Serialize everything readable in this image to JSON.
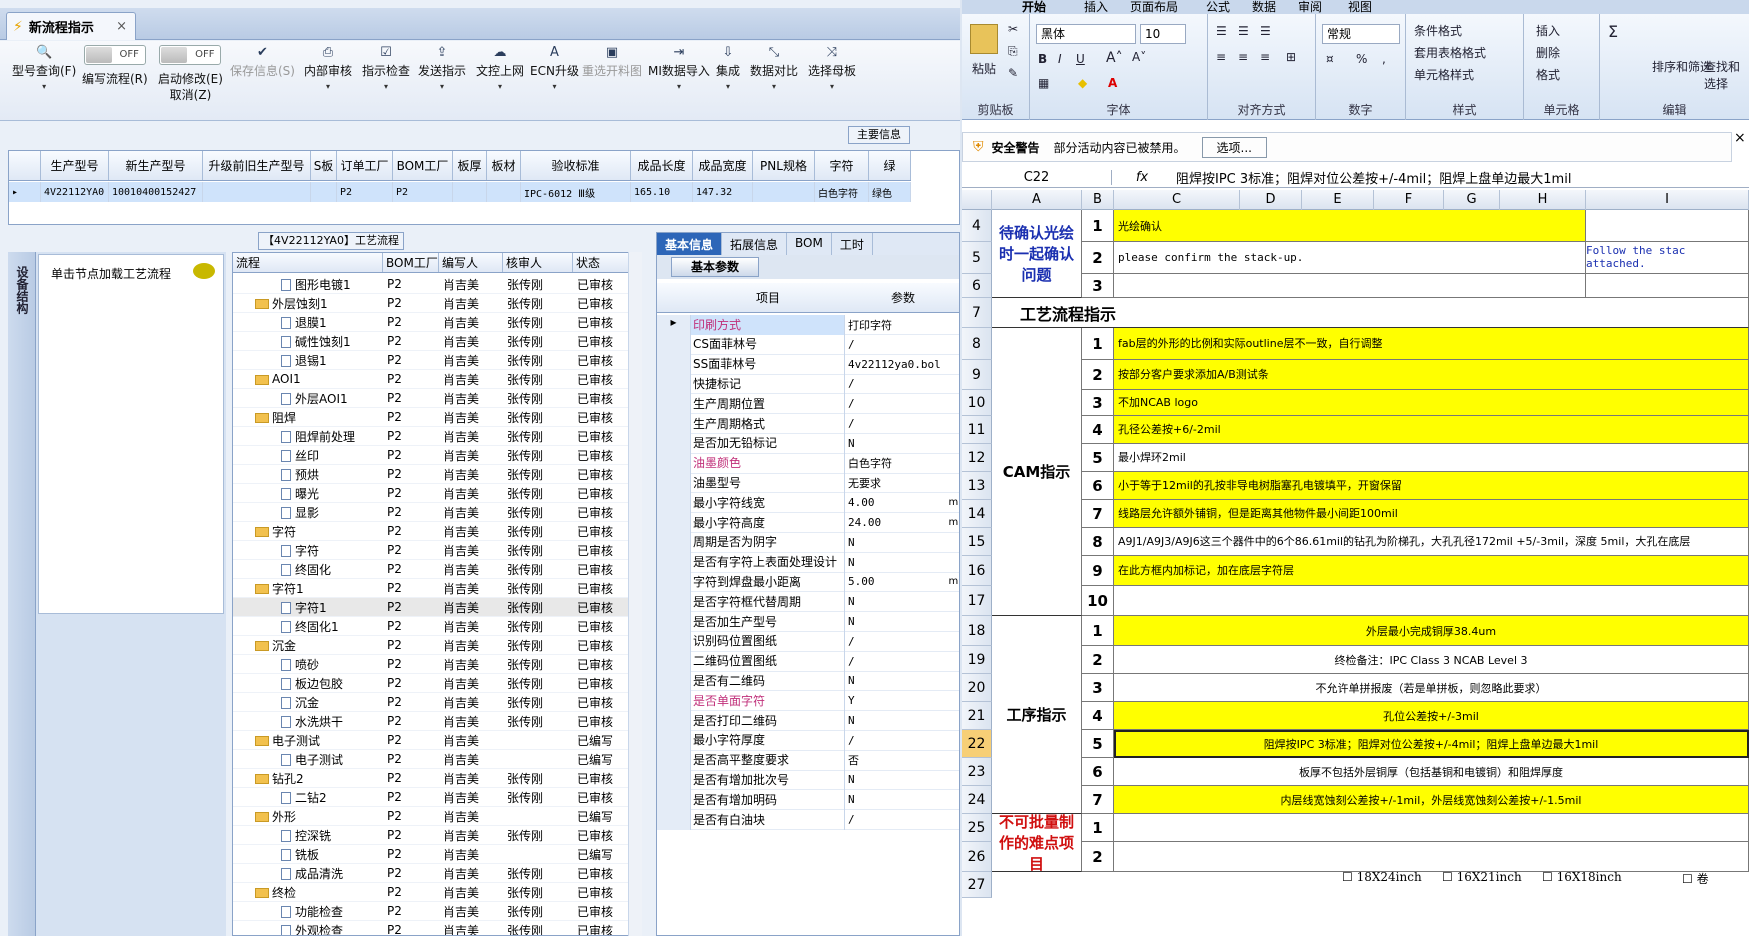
{
  "left": {
    "tab_title": "新流程指示",
    "toolbar": [
      {
        "label": "型号查询(F)",
        "icon": "search-icon"
      },
      {
        "label": "编写流程(R)",
        "icon": "toggle-off"
      },
      {
        "label": "启动修改(E)",
        "sub": "取消(Z)",
        "icon": "toggle-off"
      },
      {
        "label": "保存信息(S)",
        "icon": "check-icon",
        "disabled": true
      },
      {
        "label": "内部审核",
        "icon": "printer-icon"
      },
      {
        "label": "指示检查",
        "icon": "checkbox-icon"
      },
      {
        "label": "发送指示",
        "icon": "upload-icon"
      },
      {
        "label": "文控上网",
        "icon": "cloud-upload-icon"
      },
      {
        "label": "ECN升级",
        "icon": "ecn-icon"
      },
      {
        "label": "重选开料图",
        "icon": "image-icon",
        "disabled": true
      },
      {
        "label": "MI数据导入",
        "icon": "import-icon"
      },
      {
        "label": "集成",
        "icon": "download-icon"
      },
      {
        "label": "数据对比",
        "icon": "compare-icon"
      },
      {
        "label": "选择母板",
        "icon": "shuffle-icon"
      }
    ],
    "toggle_text": "OFF",
    "main_info_tab": "主要信息",
    "grid_headers": [
      "生产型号",
      "新生产型号",
      "升级前旧生产型号",
      "S板",
      "订单工厂",
      "BOM工厂",
      "板厚",
      "板材",
      "验收标准",
      "成品长度",
      "成品宽度",
      "PNL规格",
      "字符",
      "绿"
    ],
    "grid_row": [
      "4V22112YA0",
      "10010400152427",
      "",
      "",
      "P2",
      "P2",
      "",
      "",
      "IPC-6012 Ⅲ级",
      "165.10",
      "147.32",
      "",
      "白色字符",
      "绿色"
    ],
    "flow_title": "【4V22112YA0】工艺流程",
    "sidebar_label": "设备结构",
    "left_hint": "单击节点加载工艺流程",
    "tree_headers": [
      "流程",
      "BOM工厂",
      "编写人",
      "核审人",
      "状态"
    ],
    "tree_rows": [
      {
        "name": "图形电镀1",
        "lvl": 2,
        "bom": "P2",
        "w": "肖吉美",
        "r": "张传刚",
        "s": "已审核"
      },
      {
        "name": "外层蚀刻1",
        "lvl": 1,
        "bom": "P2",
        "w": "肖吉美",
        "r": "张传刚",
        "s": "已审核"
      },
      {
        "name": "退膜1",
        "lvl": 2,
        "bom": "P2",
        "w": "肖吉美",
        "r": "张传刚",
        "s": "已审核"
      },
      {
        "name": "碱性蚀刻1",
        "lvl": 2,
        "bom": "P2",
        "w": "肖吉美",
        "r": "张传刚",
        "s": "已审核"
      },
      {
        "name": "退锡1",
        "lvl": 2,
        "bom": "P2",
        "w": "肖吉美",
        "r": "张传刚",
        "s": "已审核"
      },
      {
        "name": "AOI1",
        "lvl": 1,
        "bom": "P2",
        "w": "肖吉美",
        "r": "张传刚",
        "s": "已审核"
      },
      {
        "name": "外层AOI1",
        "lvl": 2,
        "bom": "P2",
        "w": "肖吉美",
        "r": "张传刚",
        "s": "已审核"
      },
      {
        "name": "阻焊",
        "lvl": 1,
        "bom": "P2",
        "w": "肖吉美",
        "r": "张传刚",
        "s": "已审核"
      },
      {
        "name": "阻焊前处理",
        "lvl": 2,
        "bom": "P2",
        "w": "肖吉美",
        "r": "张传刚",
        "s": "已审核"
      },
      {
        "name": "丝印",
        "lvl": 2,
        "bom": "P2",
        "w": "肖吉美",
        "r": "张传刚",
        "s": "已审核"
      },
      {
        "name": "预烘",
        "lvl": 2,
        "bom": "P2",
        "w": "肖吉美",
        "r": "张传刚",
        "s": "已审核"
      },
      {
        "name": "曝光",
        "lvl": 2,
        "bom": "P2",
        "w": "肖吉美",
        "r": "张传刚",
        "s": "已审核"
      },
      {
        "name": "显影",
        "lvl": 2,
        "bom": "P2",
        "w": "肖吉美",
        "r": "张传刚",
        "s": "已审核"
      },
      {
        "name": "字符",
        "lvl": 1,
        "bom": "P2",
        "w": "肖吉美",
        "r": "张传刚",
        "s": "已审核"
      },
      {
        "name": "字符",
        "lvl": 2,
        "bom": "P2",
        "w": "肖吉美",
        "r": "张传刚",
        "s": "已审核"
      },
      {
        "name": "终固化",
        "lvl": 2,
        "bom": "P2",
        "w": "肖吉美",
        "r": "张传刚",
        "s": "已审核"
      },
      {
        "name": "字符1",
        "lvl": 1,
        "bom": "P2",
        "w": "肖吉美",
        "r": "张传刚",
        "s": "已审核"
      },
      {
        "name": "字符1",
        "lvl": 2,
        "bom": "P2",
        "w": "肖吉美",
        "r": "张传刚",
        "s": "已审核",
        "sel": true
      },
      {
        "name": "终固化1",
        "lvl": 2,
        "bom": "P2",
        "w": "肖吉美",
        "r": "张传刚",
        "s": "已审核"
      },
      {
        "name": "沉金",
        "lvl": 1,
        "bom": "P2",
        "w": "肖吉美",
        "r": "张传刚",
        "s": "已审核"
      },
      {
        "name": "喷砂",
        "lvl": 2,
        "bom": "P2",
        "w": "肖吉美",
        "r": "张传刚",
        "s": "已审核"
      },
      {
        "name": "板边包胶",
        "lvl": 2,
        "bom": "P2",
        "w": "肖吉美",
        "r": "张传刚",
        "s": "已审核"
      },
      {
        "name": "沉金",
        "lvl": 2,
        "bom": "P2",
        "w": "肖吉美",
        "r": "张传刚",
        "s": "已审核"
      },
      {
        "name": "水洗烘干",
        "lvl": 2,
        "bom": "P2",
        "w": "肖吉美",
        "r": "张传刚",
        "s": "已审核"
      },
      {
        "name": "电子测试",
        "lvl": 1,
        "bom": "P2",
        "w": "肖吉美",
        "r": "",
        "s": "已编写"
      },
      {
        "name": "电子测试",
        "lvl": 2,
        "bom": "P2",
        "w": "肖吉美",
        "r": "",
        "s": "已编写"
      },
      {
        "name": "钻孔2",
        "lvl": 1,
        "bom": "P2",
        "w": "肖吉美",
        "r": "张传刚",
        "s": "已审核"
      },
      {
        "name": "二钻2",
        "lvl": 2,
        "bom": "P2",
        "w": "肖吉美",
        "r": "张传刚",
        "s": "已审核"
      },
      {
        "name": "外形",
        "lvl": 1,
        "bom": "P2",
        "w": "肖吉美",
        "r": "",
        "s": "已编写"
      },
      {
        "name": "控深铣",
        "lvl": 2,
        "bom": "P2",
        "w": "肖吉美",
        "r": "张传刚",
        "s": "已审核"
      },
      {
        "name": "铣板",
        "lvl": 2,
        "bom": "P2",
        "w": "肖吉美",
        "r": "",
        "s": "已编写"
      },
      {
        "name": "成品清洗",
        "lvl": 2,
        "bom": "P2",
        "w": "肖吉美",
        "r": "张传刚",
        "s": "已审核"
      },
      {
        "name": "终检",
        "lvl": 1,
        "bom": "P2",
        "w": "肖吉美",
        "r": "张传刚",
        "s": "已审核"
      },
      {
        "name": "功能检查",
        "lvl": 2,
        "bom": "P2",
        "w": "肖吉美",
        "r": "张传刚",
        "s": "已审核"
      },
      {
        "name": "外观检查",
        "lvl": 2,
        "bom": "P2",
        "w": "肖吉美",
        "r": "张传刚",
        "s": "已审核"
      }
    ],
    "prop_tabs": [
      "基本信息",
      "拓展信息",
      "BOM",
      "工时"
    ],
    "prop_subtab": "基本参数",
    "prop_headers": [
      "项目",
      "参数"
    ],
    "props": [
      {
        "k": "印刷方式",
        "v": "打印字符",
        "pink": true,
        "cur": true
      },
      {
        "k": "CS面菲林号",
        "v": "/"
      },
      {
        "k": "SS面菲林号",
        "v": "4v22112ya0.bol"
      },
      {
        "k": "快捷标记",
        "v": "/"
      },
      {
        "k": "生产周期位置",
        "v": "/"
      },
      {
        "k": "生产周期格式",
        "v": "/"
      },
      {
        "k": "是否加无铅标记",
        "v": "N"
      },
      {
        "k": "油墨颜色",
        "v": "白色字符",
        "pink": true
      },
      {
        "k": "油墨型号",
        "v": "无要求"
      },
      {
        "k": "最小字符线宽",
        "v": "4.00",
        "u": "mi"
      },
      {
        "k": "最小字符高度",
        "v": "24.00",
        "u": "mi"
      },
      {
        "k": "周期是否为阴字",
        "v": "N"
      },
      {
        "k": "是否有字符上表面处理设计",
        "v": "N"
      },
      {
        "k": "字符到焊盘最小距离",
        "v": "5.00",
        "u": "mi"
      },
      {
        "k": "是否字符框代替周期",
        "v": "N"
      },
      {
        "k": "是否加生产型号",
        "v": "N"
      },
      {
        "k": "识别码位置图纸",
        "v": "/"
      },
      {
        "k": "二维码位置图纸",
        "v": "/"
      },
      {
        "k": "是否有二维码",
        "v": "N"
      },
      {
        "k": "是否单面字符",
        "v": "Y",
        "pink": true
      },
      {
        "k": "是否打印二维码",
        "v": "N"
      },
      {
        "k": "最小字符厚度",
        "v": "/"
      },
      {
        "k": "是否高平整度要求",
        "v": "否"
      },
      {
        "k": "是否有增加批次号",
        "v": "N"
      },
      {
        "k": "是否有增加明码",
        "v": "N"
      },
      {
        "k": "是否有白油块",
        "v": "/"
      }
    ]
  },
  "right": {
    "ribbon_tabs": [
      "开始",
      "插入",
      "页面布局",
      "公式",
      "数据",
      "审阅",
      "视图"
    ],
    "clipboard": {
      "paste": "粘贴",
      "cap": "剪贴板"
    },
    "font": {
      "name": "黑体",
      "size": "10",
      "cap": "字体"
    },
    "align_cap": "对齐方式",
    "number": {
      "format": "常规",
      "cap": "数字"
    },
    "styles": {
      "items": [
        "条件格式",
        "套用表格格式",
        "单元格样式"
      ],
      "cap": "样式"
    },
    "cells": {
      "items": [
        "插入",
        "删除",
        "格式"
      ],
      "cap": "单元格"
    },
    "edit": {
      "sort": "排序和筛选",
      "find": "查找和选择",
      "cap": "编辑"
    },
    "security": {
      "label": "安全警告",
      "msg": "部分活动内容已被禁用。",
      "button": "选项..."
    },
    "namebox": "C22",
    "formula": "阻焊按IPC 3标准；阻焊对位公差按+/-4mil；阻焊上盘单边最大1mil",
    "cols": [
      "A",
      "B",
      "C",
      "D",
      "E",
      "F",
      "G",
      "H",
      "I"
    ],
    "rows": [
      "4",
      "5",
      "6",
      "7",
      "8",
      "9",
      "10",
      "11",
      "12",
      "13",
      "14",
      "15",
      "16",
      "17",
      "18",
      "19",
      "20",
      "21",
      "22",
      "23",
      "24",
      "25",
      "26",
      "27"
    ],
    "blocks": {
      "confirm": "待确认光绘时一起确认问题",
      "flow": "工艺流程指示",
      "cam": "CAM指示",
      "proc": "工序指示",
      "hard": "不可批量制作的难点项目"
    },
    "confirm_items": [
      {
        "n": "1",
        "t": "光绘确认"
      },
      {
        "n": "2",
        "t": "please confirm the stack-up.",
        "side": "Follow the stac attached."
      },
      {
        "n": "3",
        "t": ""
      }
    ],
    "cam_items": [
      {
        "n": "1",
        "t": "fab层的外形的比例和实际outline层不一致，自行调整"
      },
      {
        "n": "2",
        "t": "按部分客户要求添加A/B测试条"
      },
      {
        "n": "3",
        "t": "不加NCAB logo"
      },
      {
        "n": "4",
        "t": "孔径公差按+6/-2mil"
      },
      {
        "n": "5",
        "t": "最小焊环2mil"
      },
      {
        "n": "6",
        "t": "小于等于12mil的孔按非导电树脂塞孔电镀填平，开窗保留"
      },
      {
        "n": "7",
        "t": "线路层允许额外铺铜，但是距离其他物件最小间距100mil"
      },
      {
        "n": "8",
        "t": "A9J1/A9J3/A9J6这三个器件中的6个86.61mil的钻孔为阶梯孔，大孔孔径172mil +5/-3mil，深度 5mil，大孔在底层"
      },
      {
        "n": "9",
        "t": "在此方框内加标记，加在底层字符层"
      },
      {
        "n": "10",
        "t": ""
      }
    ],
    "proc_items": [
      {
        "n": "1",
        "t": "外层最小完成铜厚38.4um"
      },
      {
        "n": "2",
        "t": "终检备注：IPC Class 3 NCAB Level 3"
      },
      {
        "n": "3",
        "t": "不允许单拼报废（若是单拼板，则忽略此要求）"
      },
      {
        "n": "4",
        "t": "孔位公差按+/-3mil"
      },
      {
        "n": "5",
        "t": "阻焊按IPC 3标准；阻焊对位公差按+/-4mil；阻焊上盘单边最大1mil"
      },
      {
        "n": "6",
        "t": "板厚不包括外层铜厚（包括基铜和电镀铜）和阻焊厚度"
      },
      {
        "n": "7",
        "t": "内层线宽蚀刻公差按+/-1mil，外层线宽蚀刻公差按+/-1.5mil"
      }
    ],
    "hard_items": [
      {
        "n": "1"
      },
      {
        "n": "2"
      }
    ],
    "bottom_checks": [
      "18X24inch",
      "16X21inch",
      "16X18inch",
      "卷"
    ]
  }
}
